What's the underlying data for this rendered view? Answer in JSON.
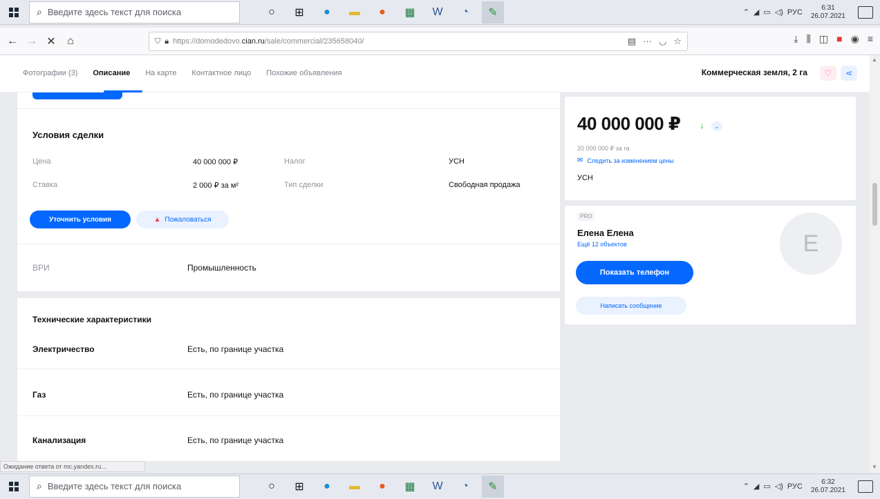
{
  "taskbar": {
    "search_placeholder": "Введите здесь текст для поиска",
    "lang": "РУС",
    "top_time": "6:31",
    "top_date": "26.07.2021",
    "bottom_time": "6:32",
    "bottom_date": "26.07.2021"
  },
  "browser": {
    "url_prefix": "https://domodedovo.",
    "url_domain": "cian.ru",
    "url_suffix": "/sale/commercial/235658040/"
  },
  "header": {
    "tabs": [
      "Фотографии (3)",
      "Описание",
      "На карте",
      "Контактное лицо",
      "Похожие объявления"
    ],
    "title": "Коммерческая земля, 2 га"
  },
  "deal": {
    "title": "Условия сделки",
    "price_label": "Цена",
    "price_value": "40 000 000 ₽",
    "rate_label": "Ставка",
    "rate_value": "2 000 ₽ за м²",
    "tax_label": "Налог",
    "tax_value": "УСН",
    "dealtype_label": "Тип сделки",
    "dealtype_value": "Свободная продажа",
    "clarify_button": "Уточнить условия",
    "complain_button": "Пожаловаться"
  },
  "vri": {
    "label": "ВРИ",
    "value": "Промышленность"
  },
  "tech": {
    "title": "Технические характеристики",
    "rows": [
      {
        "label": "Электричество",
        "value": "Есть, по границе участка"
      },
      {
        "label": "Газ",
        "value": "Есть, по границе участка"
      },
      {
        "label": "Канализация",
        "value": "Есть, по границе участка"
      }
    ]
  },
  "side": {
    "price": "40 000 000 ₽",
    "price_per": "20 000 000 ₽ за га",
    "watch_price": "Следить за изменением цены",
    "tax": "УСН",
    "pro_badge": "PRO",
    "agent_name": "Елена Елена",
    "more_objects": "Ещё 12 объектов",
    "show_phone": "Показать телефон",
    "write_message": "Написать сообщение",
    "avatar_letter": "Е"
  },
  "status_text": "Ожидание ответа от mc.yandex.ru…",
  "colors": {
    "accent": "#0468ff",
    "down_arrow": "#2eb82e"
  }
}
